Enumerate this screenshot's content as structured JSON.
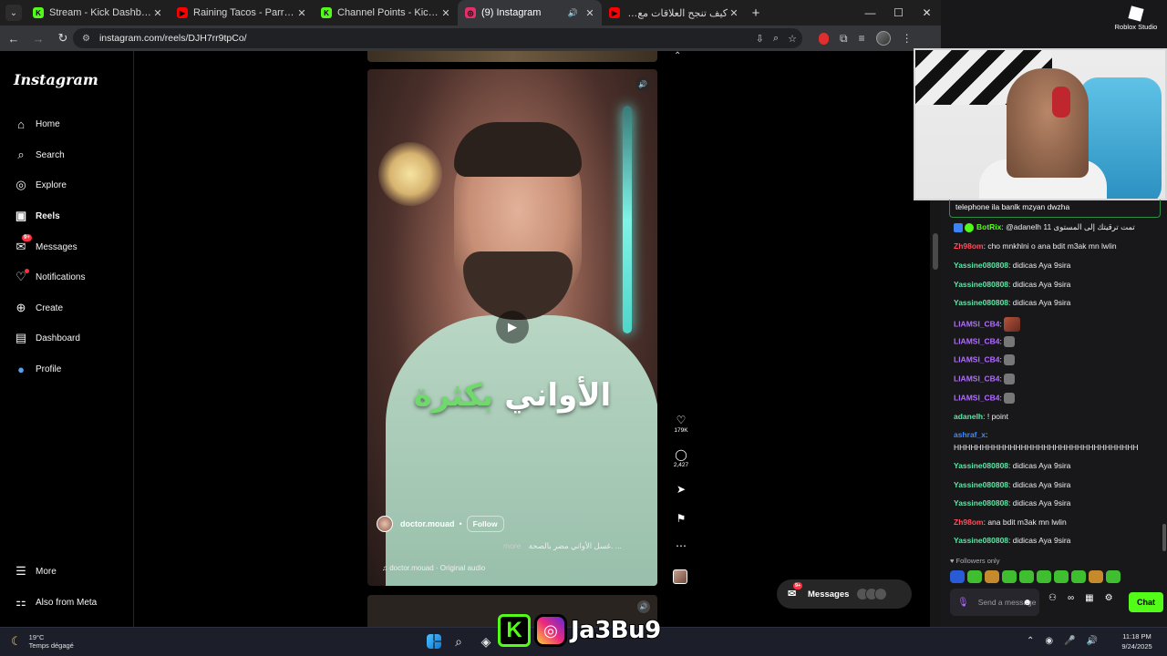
{
  "browser": {
    "tabs": [
      {
        "title": "Stream - Kick Dashboard",
        "favicon_color": "#53fc18",
        "favicon_letter": "K",
        "active": false
      },
      {
        "title": "Raining Tacos - Parry Gripp & B",
        "favicon_color": "#ff0000",
        "favicon_letter": "▶",
        "active": false
      },
      {
        "title": "Channel Points - Kick Dashboard",
        "favicon_color": "#53fc18",
        "favicon_letter": "K",
        "active": false
      },
      {
        "title": "(9) Instagram",
        "favicon_color": "#e1306c",
        "favicon_letter": "◎",
        "active": true
      },
      {
        "title": "كيف تنجح العلاقات مع ياسر الحزي",
        "favicon_color": "#ff0000",
        "favicon_letter": "▶",
        "active": false
      }
    ],
    "url": "instagram.com/reels/DJH7rr9tpCo/"
  },
  "instagram": {
    "logo": "Instagram",
    "nav": [
      {
        "label": "Home",
        "icon": "home-icon"
      },
      {
        "label": "Search",
        "icon": "search-icon"
      },
      {
        "label": "Explore",
        "icon": "explore-icon"
      },
      {
        "label": "Reels",
        "icon": "reels-icon"
      },
      {
        "label": "Messages",
        "icon": "messages-icon",
        "badge": "9+"
      },
      {
        "label": "Notifications",
        "icon": "heart-icon"
      },
      {
        "label": "Create",
        "icon": "plus-icon"
      },
      {
        "label": "Dashboard",
        "icon": "dashboard-icon"
      },
      {
        "label": "Profile",
        "icon": "profile-icon"
      }
    ],
    "more": "More",
    "also_from_meta": "Also from Meta",
    "reel": {
      "caption_word1": "الأواني",
      "caption_word2": "بكثرة",
      "username": "doctor.mouad",
      "separator": "•",
      "follow": "Follow",
      "description": "غسل الأواني مضر بالصحة. ...",
      "more": "more",
      "audio": "♫ doctor.mouad · Original audio"
    },
    "actions": {
      "likes": "179K",
      "comments": "2,427"
    },
    "messages_pill": {
      "label": "Messages",
      "badge": "9+"
    }
  },
  "overlay": {
    "roblox_label": "Roblox Studio",
    "pinned_text": "telephone ila banlk mzyan dwzha",
    "chat": [
      {
        "user": "BotRix",
        "color": "green",
        "text": ": @adanelh 11 تمت ترقيتك إلى المستوى",
        "bot": true
      },
      {
        "user": "Zh98om",
        "color": "red",
        "text": ": cho mnkhlni o ana bdit m3ak mn lwlin"
      },
      {
        "user": "Yassine080808",
        "color": "teal",
        "text": ": didicas Aya 9sira"
      },
      {
        "user": "Yassine080808",
        "color": "teal",
        "text": ": didicas Aya 9sira"
      },
      {
        "user": "Yassine080808",
        "color": "teal",
        "text": ": didicas Aya 9sira"
      },
      {
        "user": "LIAMSI_CB4",
        "color": "purple",
        "text": ":",
        "emote": "face"
      },
      {
        "user": "LIAMSI_CB4",
        "color": "purple",
        "text": ":",
        "emote": "small"
      },
      {
        "user": "LIAMSI_CB4",
        "color": "purple",
        "text": ":",
        "emote": "small"
      },
      {
        "user": "LIAMSI_CB4",
        "color": "purple",
        "text": ":",
        "emote": "small"
      },
      {
        "user": "LIAMSI_CB4",
        "color": "purple",
        "text": ":",
        "emote": "small"
      },
      {
        "user": "adanelh",
        "color": "teal",
        "text": ": ! point"
      },
      {
        "user": "ashraf_x",
        "color": "blue",
        "text": ":"
      },
      {
        "user": "",
        "color": "teal",
        "text": "HHHHHHHHHHHHHHHHHHHHHHHHHHHHHHHHH"
      },
      {
        "user": "Yassine080808",
        "color": "teal",
        "text": ": didicas Aya 9sira"
      },
      {
        "user": "Yassine080808",
        "color": "teal",
        "text": ": didicas Aya 9sira"
      },
      {
        "user": "Yassine080808",
        "color": "teal",
        "text": ": didicas Aya 9sira"
      },
      {
        "user": "Zh98om",
        "color": "red",
        "text": ": ana bdit m3ak mn lwlin"
      },
      {
        "user": "Yassine080808",
        "color": "teal",
        "text": ": didicas Aya 9sira"
      }
    ],
    "followers_only": "♥ Followers only",
    "input_placeholder": "Send a message",
    "chat_button": "Chat"
  },
  "taskbar": {
    "temp": "19°C",
    "weather": "Temps dégagé",
    "brand_name": "Ja3Bu9",
    "time": "11:18 PM",
    "date": "9/24/2025"
  }
}
